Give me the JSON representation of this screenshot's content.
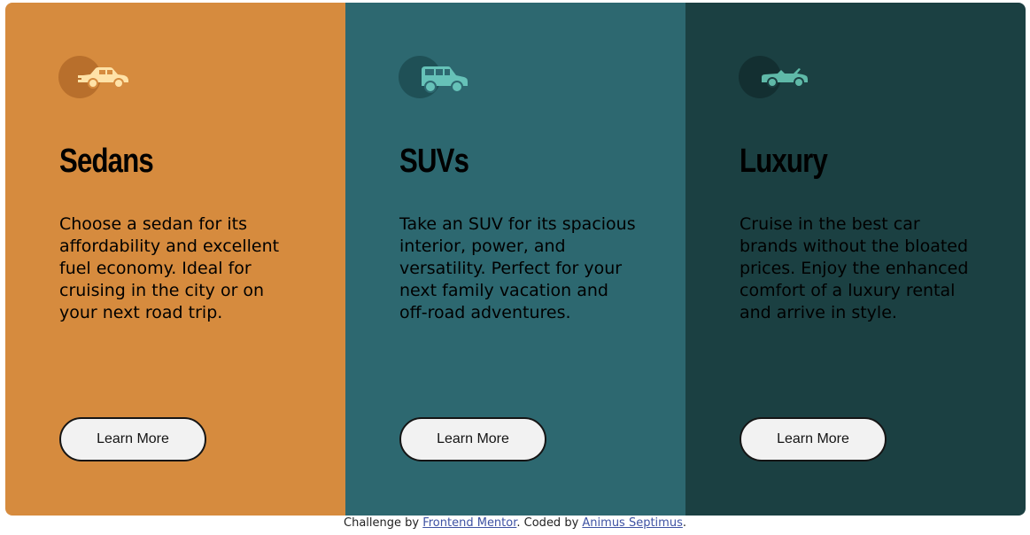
{
  "cards": [
    {
      "title": "Sedans",
      "description": "Choose a sedan for its affordability and excellent fuel economy. Ideal for cruising in the city or on your next road trip.",
      "button_label": "Learn More",
      "icon": "sedan-car-icon",
      "background": "#d68b3e",
      "icon_color": "#ffe2a7"
    },
    {
      "title": "SUVs",
      "description": "Take an SUV for its spacious interior, power, and versatility. Perfect for your next family vacation and off-road adventures.",
      "button_label": "Learn More",
      "icon": "suv-car-icon",
      "background": "#2d6870",
      "icon_color": "#66c2b8"
    },
    {
      "title": "Luxury",
      "description": "Cruise in the best car brands without the bloated prices. Enjoy the enhanced comfort of a luxury rental and arrive in style.",
      "button_label": "Learn More",
      "icon": "luxury-car-icon",
      "background": "#1b4042",
      "icon_color": "#5fb9a8"
    }
  ],
  "attribution": {
    "prefix": "Challenge by ",
    "link1": "Frontend Mentor",
    "middle": ". Coded by ",
    "link2": "Animus Septimus",
    "suffix": "."
  }
}
